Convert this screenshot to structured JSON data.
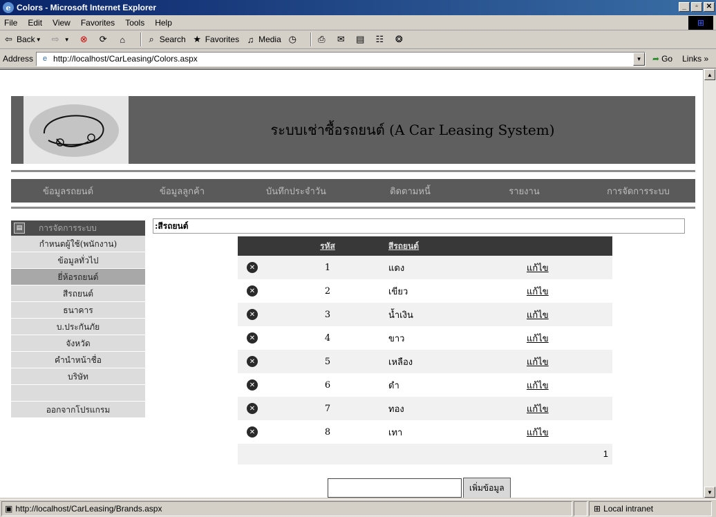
{
  "window": {
    "title": "Colors - Microsoft Internet Explorer"
  },
  "menu": [
    "File",
    "Edit",
    "View",
    "Favorites",
    "Tools",
    "Help"
  ],
  "toolbar": {
    "back": "Back",
    "search": "Search",
    "favorites": "Favorites",
    "media": "Media"
  },
  "address": {
    "label": "Address",
    "url": "http://localhost/CarLeasing/Colors.aspx",
    "go": "Go",
    "links": "Links »"
  },
  "site": {
    "title": "ระบบเช่าซื้อรถยนต์ (A Car Leasing System)",
    "nav": [
      "ข้อมูลรถยนต์",
      "ข้อมูลลูกค้า",
      "บันทึกประจำวัน",
      "ติดตามหนี้",
      "รายงาน",
      "การจัดการระบบ"
    ]
  },
  "sidebar": {
    "header": "การจัดการระบบ",
    "items": [
      "กำหนดผู้ใช้(พนักงาน)",
      "ข้อมูลทั่วไป",
      "ยี่ห้อรถยนต์",
      "สีรถยนต์",
      "ธนาคาร",
      "บ.ประกันภัย",
      "จังหวัด",
      "คำนำหน้าชื่อ",
      "บริษัท",
      "",
      "ออกจากโปรแกรม"
    ]
  },
  "crumb": ":สีรถยนต์",
  "grid": {
    "headers": {
      "code": "รหัส",
      "color": "สีรถยนต์"
    },
    "rows": [
      {
        "code": "1",
        "color": "แดง",
        "edit": "แก้ไข"
      },
      {
        "code": "2",
        "color": "เขียว",
        "edit": "แก้ไข"
      },
      {
        "code": "3",
        "color": "น้ำเงิน",
        "edit": "แก้ไข"
      },
      {
        "code": "4",
        "color": "ขาว",
        "edit": "แก้ไข"
      },
      {
        "code": "5",
        "color": "เหลือง",
        "edit": "แก้ไข"
      },
      {
        "code": "6",
        "color": "ดำ",
        "edit": "แก้ไข"
      },
      {
        "code": "7",
        "color": "ทอง",
        "edit": "แก้ไข"
      },
      {
        "code": "8",
        "color": "เทา",
        "edit": "แก้ไข"
      }
    ],
    "pager": "1"
  },
  "add_button": "เพิ่มข้อมูล",
  "status": {
    "url": "http://localhost/CarLeasing/Brands.aspx",
    "zone": "Local intranet"
  }
}
